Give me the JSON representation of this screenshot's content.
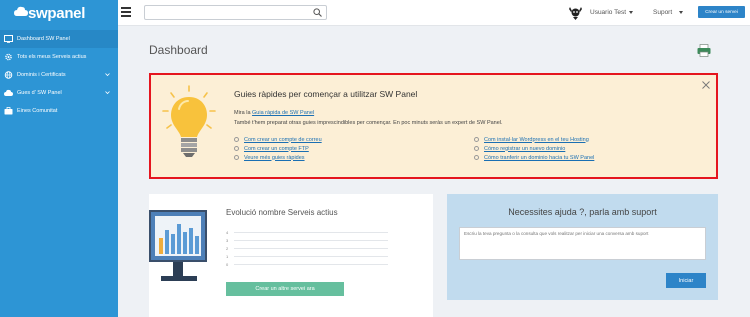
{
  "app": {
    "logo_text": "swpanel"
  },
  "sidebar": {
    "items": [
      {
        "label": "Dashboard SW Panel",
        "icon": "dashboard-icon"
      },
      {
        "label": "Tots els meus Serveis actius",
        "icon": "gears-icon"
      },
      {
        "label": "Dominis i Certificats",
        "icon": "globe-icon"
      },
      {
        "label": "Gues d' SW Panel",
        "icon": "cloud-icon"
      },
      {
        "label": "Eines Comunitat",
        "icon": "briefcase-icon"
      }
    ]
  },
  "topbar": {
    "search_placeholder": "",
    "user_name": "Usuario Test",
    "support_label": "Suport",
    "create_button": "Crear un servei"
  },
  "main": {
    "title": "Dashboard",
    "guide": {
      "title": "Guies ràpides per començar a utilitzar SW Panel",
      "intro_prefix": "Mira la ",
      "intro_link": "Guia ràpida de SW Panel",
      "intro2": "També t'hem preparat otras guies imprescindibles per començar. En poc minuts seràs un expert de SW Panel.",
      "links_left": [
        "Com crear un compte de correu",
        "Com crear un compte FTP",
        "Veure més guies ràpides"
      ],
      "links_right": [
        "Com instal·lar Wordpress en el teu Hosting",
        "Cómo registrar un nuevo dominio",
        "Cómo tranferir un dominio hacia tu SW Panel"
      ]
    },
    "services_card": {
      "title": "Evolució nombre Serveis actius",
      "ticks": [
        "4",
        "3",
        "2",
        "1",
        "0"
      ],
      "button": "Crear un altre servei ara"
    },
    "help_card": {
      "title": "Necessites ajuda ?, parla amb suport",
      "placeholder": "Escriu la teva pregunta o la consulta que vols realitzar per iniciar una conversa amb suport",
      "button": "Iniciar"
    }
  }
}
